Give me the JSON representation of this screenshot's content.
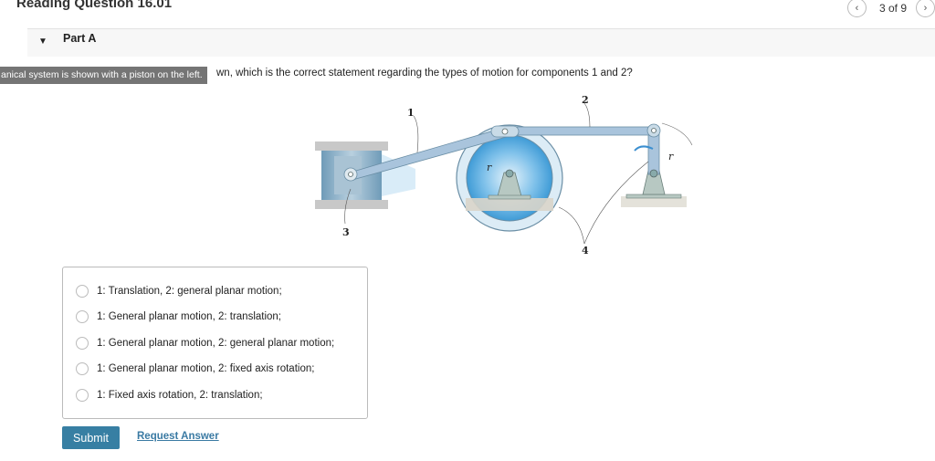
{
  "header": {
    "title": "Reading Question 16.01",
    "pagination": {
      "current": 3,
      "total": 9,
      "label": "3 of 9",
      "prev_icon": "‹",
      "next_icon": "›"
    }
  },
  "part": {
    "label": "Part A",
    "expanded": true,
    "caret_icon": "▼"
  },
  "question": {
    "tooltip": "anical system is shown with a piston on the left.",
    "text": "wn, which is the correct statement regarding the types of motion for components 1 and 2?"
  },
  "figure": {
    "labels": {
      "one": "1",
      "two": "2",
      "three": "3",
      "four": "4",
      "r1": "r",
      "r2": "r"
    },
    "colors": {
      "link": "#a9c4dc",
      "metal": "#b7c8cf",
      "blue": "#5aaee3",
      "ground": "#d4d0c4"
    }
  },
  "answers": {
    "options": [
      {
        "label": "1: Translation, 2: general planar motion;",
        "selected": false
      },
      {
        "label": "1: General planar motion, 2: translation;",
        "selected": false
      },
      {
        "label": "1: General planar motion, 2: general planar motion;",
        "selected": false
      },
      {
        "label": "1: General planar motion, 2: fixed axis rotation;",
        "selected": false
      },
      {
        "label": "1: Fixed axis rotation, 2: translation;",
        "selected": false
      }
    ]
  },
  "actions": {
    "submit_label": "Submit",
    "request_label": "Request Answer"
  },
  "colors": {
    "submit_bg": "#377fa3",
    "link": "#3a7aa3"
  }
}
